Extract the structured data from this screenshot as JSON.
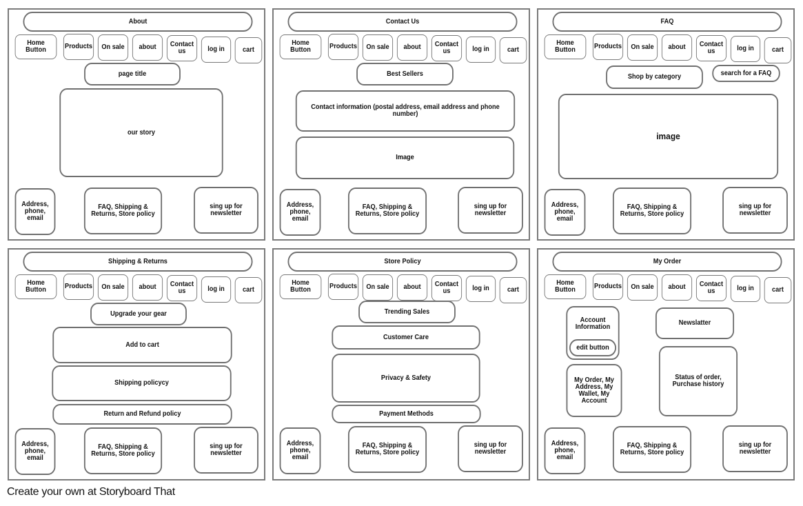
{
  "nav": [
    "Home Button",
    "Products",
    "On sale",
    "about",
    "Contact us",
    "log in",
    "cart"
  ],
  "footer": {
    "contact": "Address, phone, email",
    "links": "FAQ, Shipping & Returns, Store policy",
    "newsletter": "sing up for newsletter"
  },
  "panels": {
    "about": {
      "title": "About",
      "page_title": "page title",
      "story": "our story",
      "contact": "Address, phone, email"
    },
    "contact": {
      "title": "Contact Us",
      "best_sellers": "Best Sellers",
      "contact_info": "Contact information (postal address, email address and phone number)",
      "image": "Image"
    },
    "faq": {
      "title": "FAQ",
      "shop_by_category": "Shop by category",
      "search_faq": "search for a FAQ",
      "image": "image"
    },
    "shipping": {
      "title": "Shipping & Returns",
      "upgrade": "Upgrade your gear",
      "add_to_cart": "Add to cart",
      "shipping_policy": "Shipping policycy",
      "return_refund": "Return and Refund policy"
    },
    "store_policy": {
      "title": "Store Policy",
      "trending": "Trending Sales",
      "customer_care": "Customer Care",
      "privacy": "Privacy & Safety",
      "payment": "Payment Methods"
    },
    "my_order": {
      "title": "My Order",
      "account_info": "Account Information",
      "edit_button": "edit button",
      "newsletter": "Newslatter",
      "account_links": "My Order, My Address, My Wallet, My Account",
      "status": "Status of order, Purchase history"
    }
  },
  "credit": "Create your own at Storyboard That"
}
